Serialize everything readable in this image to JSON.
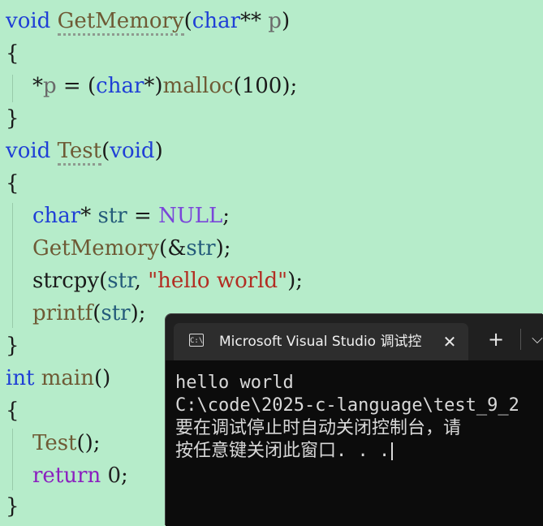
{
  "code": {
    "l1": {
      "kw": "void",
      "fn": "GetMemory",
      "p1": "(",
      "type": "char",
      "stars": "** ",
      "param": "p",
      "p2": ")"
    },
    "l2": "{",
    "l3": {
      "deref": "*",
      "param": "p",
      "eq": " = ",
      "lp": "(",
      "type": "char",
      "cast": "*)",
      "fn": "malloc",
      "args": "(100);"
    },
    "l4": "}",
    "l5": {
      "kw": "void",
      "fn": "Test",
      "p1": "(",
      "arg": "void",
      "p2": ")"
    },
    "l6": "{",
    "l7": {
      "type": "char",
      "rest": "* ",
      "var": "str",
      "eq": " = ",
      "const": "NULL",
      "semi": ";"
    },
    "l8": {
      "fn": "GetMemory",
      "open": "(&",
      "var": "str",
      "close": ");"
    },
    "l9": {
      "fn": "strcpy",
      "open": "(",
      "var": "str",
      "comma": ", ",
      "str": "\"hello world\"",
      "close": ");"
    },
    "l10": {
      "fn": "printf",
      "open": "(",
      "var": "str",
      "close": ");"
    },
    "l11": "}",
    "l12": {
      "kw": "int",
      "fn": "main",
      "paren": "()"
    },
    "l13": "{",
    "l14": {
      "fn": "Test",
      "rest": "();"
    },
    "l15": {
      "kw": "return",
      "num": " 0",
      "semi": ";"
    },
    "l16": "}"
  },
  "terminal": {
    "tab_title": "Microsoft Visual Studio 调试控",
    "tab_icon": "C:\\",
    "close_glyph": "✕",
    "new_tab_glyph": "+",
    "dropdown_glyph": "⌵",
    "lines": [
      "hello world",
      "C:\\code\\2025-c-language\\test_9_2",
      "要在调试停止时自动关闭控制台，请",
      "按任意键关闭此窗口. . ."
    ]
  }
}
